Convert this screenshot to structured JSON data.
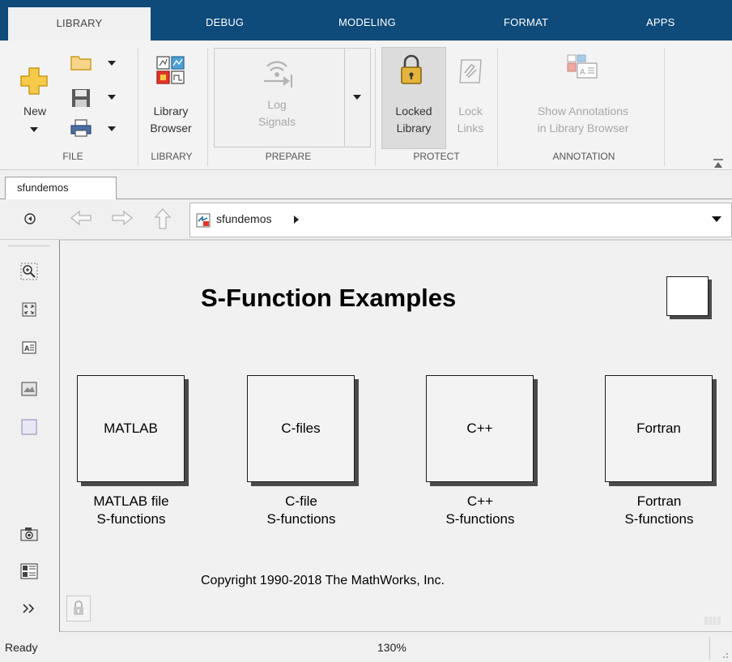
{
  "tabs": {
    "library": "LIBRARY",
    "debug": "DEBUG",
    "modeling": "MODELING",
    "format": "FORMAT",
    "apps": "APPS"
  },
  "ribbon": {
    "file": {
      "section": "FILE",
      "new_label": "New"
    },
    "library": {
      "section": "LIBRARY",
      "browser_line1": "Library",
      "browser_line2": "Browser"
    },
    "prepare": {
      "section": "PREPARE",
      "log_line1": "Log",
      "log_line2": "Signals"
    },
    "protect": {
      "section": "PROTECT",
      "locked_line1": "Locked",
      "locked_line2": "Library",
      "lock_line1": "Lock",
      "lock_line2": "Links"
    },
    "annotation": {
      "section": "ANNOTATION",
      "show_line1": "Show Annotations",
      "show_line2": "in Library Browser"
    }
  },
  "doc_tab": "sfundemos",
  "address": {
    "crumb": "sfundemos"
  },
  "canvas": {
    "title": "S-Function Examples",
    "blocks": [
      {
        "label": "MATLAB",
        "caption_line1": "MATLAB file",
        "caption_line2": "S-functions"
      },
      {
        "label": "C-files",
        "caption_line1": "C-file",
        "caption_line2": "S-functions"
      },
      {
        "label": "C++",
        "caption_line1": "C++",
        "caption_line2": "S-functions"
      },
      {
        "label": "Fortran",
        "caption_line1": "Fortran",
        "caption_line2": "S-functions"
      }
    ],
    "copyright": "Copyright 1990-2018 The MathWorks, Inc."
  },
  "status": {
    "state": "Ready",
    "zoom": "130%"
  },
  "colors": {
    "tabbar": "#0e4a7a",
    "accent_yellow": "#f7c948",
    "sim_red": "#e5332a"
  }
}
